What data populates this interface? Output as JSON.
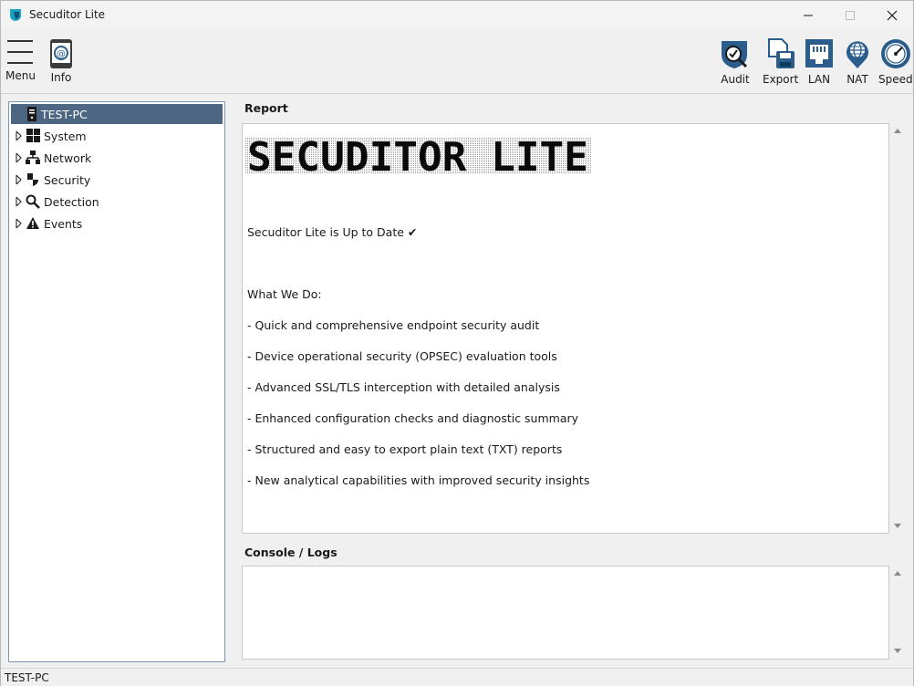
{
  "window": {
    "title": "Secuditor Lite"
  },
  "toolbar": {
    "menu_label": "Menu",
    "info_label": "Info",
    "audit_label": "Audit",
    "export_label": "Export",
    "lan_label": "LAN",
    "nat_label": "NAT",
    "speed_label": "Speed"
  },
  "tree": {
    "root": "TEST-PC",
    "items": [
      {
        "label": "System"
      },
      {
        "label": "Network"
      },
      {
        "label": "Security"
      },
      {
        "label": "Detection"
      },
      {
        "label": "Events"
      }
    ]
  },
  "report": {
    "heading": "Report",
    "banner": "SECUDITOR LITE",
    "status": "Secuditor Lite is Up to Date ✔",
    "what_we_do": "What We Do:",
    "features": [
      "- Quick and comprehensive endpoint security audit",
      "- Device operational security (OPSEC) evaluation tools",
      "- Advanced SSL/TLS interception with detailed analysis",
      "- Enhanced configuration checks and diagnostic summary",
      "- Structured and easy to export plain text (TXT) reports",
      "- New analytical capabilities with improved security insights"
    ]
  },
  "console": {
    "heading": "Console / Logs"
  },
  "statusbar": {
    "text": "TEST-PC"
  },
  "colors": {
    "selection": "#4d6782",
    "accent_blue": "#2a5d8c",
    "logo_teal": "#18a3c0"
  }
}
